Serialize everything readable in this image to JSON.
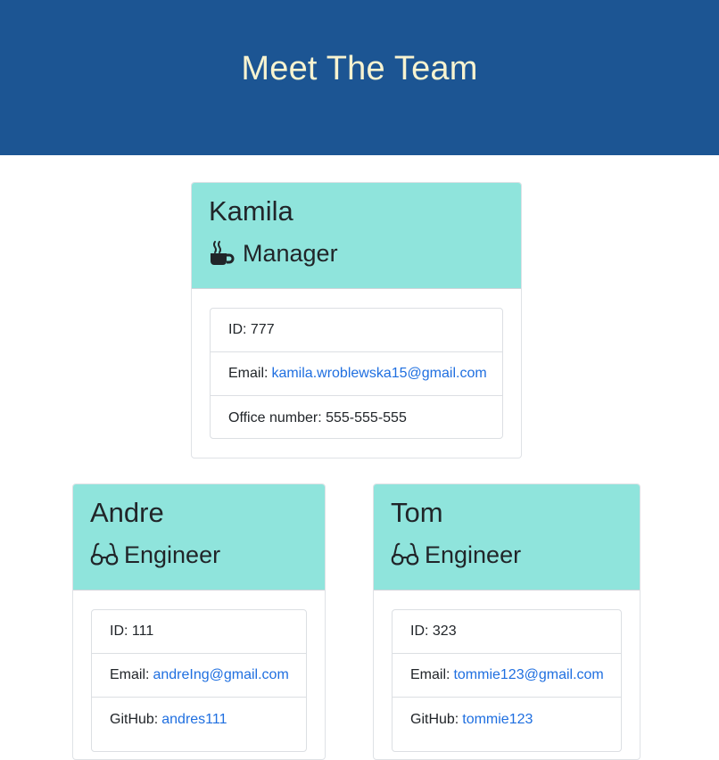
{
  "header": {
    "title": "Meet The Team"
  },
  "manager": {
    "name": "Kamila",
    "role": "Manager",
    "icon": "coffee-mug-icon",
    "id_label": "ID:",
    "id_value": "777",
    "email_label": "Email:",
    "email_value": "kamila.wroblewska15@gmail.com",
    "office_label": "Office number:",
    "office_value": "555-555-555"
  },
  "engineers": [
    {
      "name": "Andre",
      "role": "Engineer",
      "icon": "glasses-icon",
      "id_label": "ID:",
      "id_value": "111",
      "email_label": "Email:",
      "email_value": "andreIng@gmail.com",
      "github_label": "GitHub:",
      "github_value": "andres111"
    },
    {
      "name": "Tom",
      "role": "Engineer",
      "icon": "glasses-icon",
      "id_label": "ID:",
      "id_value": "323",
      "email_label": "Email:",
      "email_value": "tommie123@gmail.com",
      "github_label": "GitHub:",
      "github_value": "tommie123"
    }
  ],
  "colors": {
    "header_bg": "#1c5593",
    "title_text": "#f7f3d0",
    "card_head_bg": "#8fe4dc",
    "link": "#1f6fe0"
  }
}
